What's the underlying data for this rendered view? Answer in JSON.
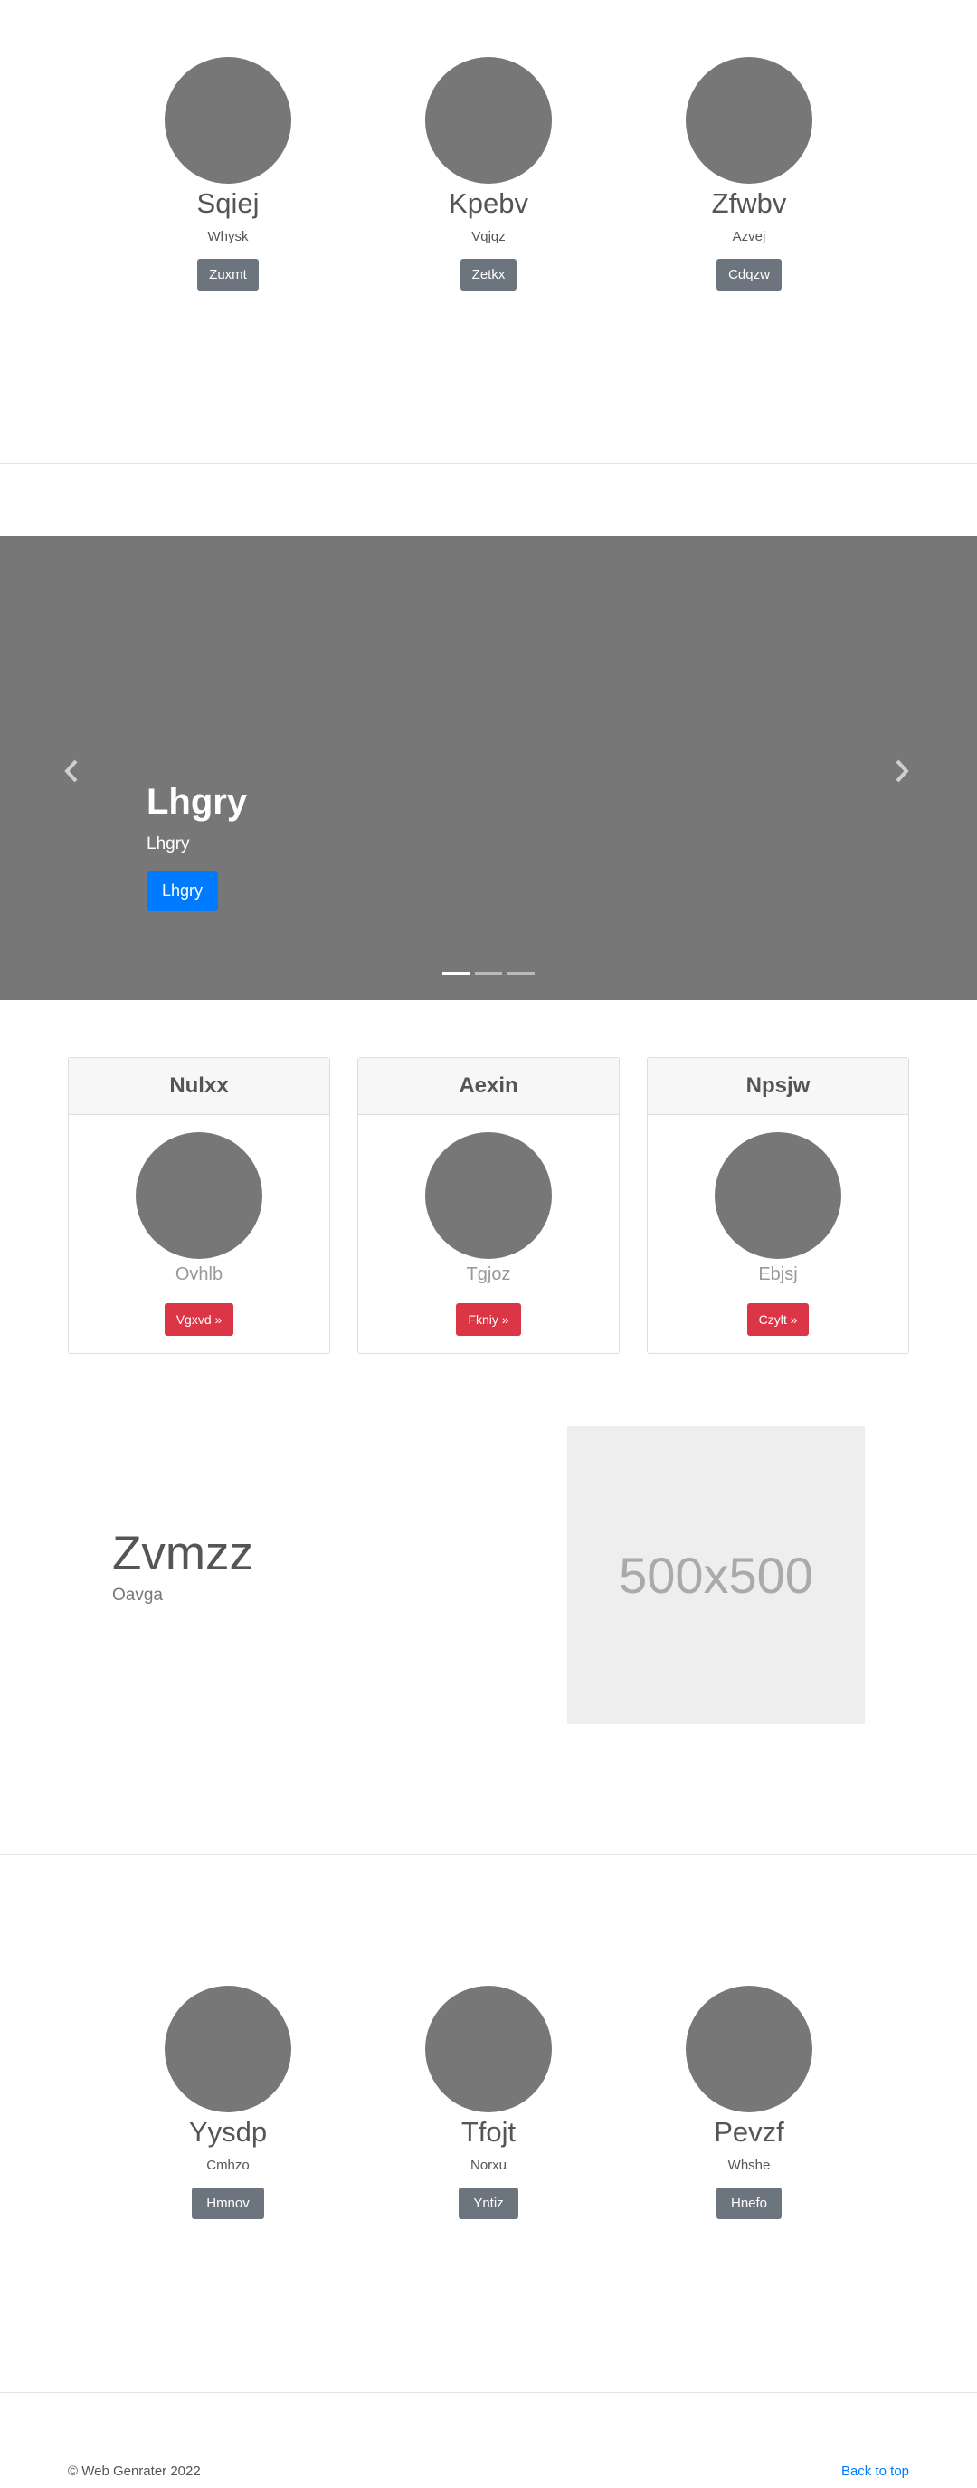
{
  "team_top": [
    {
      "name": "Sqiej",
      "sub": "Whysk",
      "button": "Zuxmt"
    },
    {
      "name": "Kpebv",
      "sub": "Vqjqz",
      "button": "Zetkx"
    },
    {
      "name": "Zfwbv",
      "sub": "Azvej",
      "button": "Cdqzw"
    }
  ],
  "carousel": {
    "title": "Lhgry",
    "subtitle": "Lhgry",
    "button": "Lhgry",
    "prev_icon": "chevron-left-icon",
    "next_icon": "chevron-right-icon",
    "indicator_count": 3,
    "active_indicator": 1
  },
  "cards": [
    {
      "title": "Nulxx",
      "sub": "Ovhlb",
      "button": "Vgxvd »"
    },
    {
      "title": "Aexin",
      "sub": "Tgjoz",
      "button": "Fkniy »"
    },
    {
      "title": "Npsjw",
      "sub": "Ebjsj",
      "button": "Czylt »"
    }
  ],
  "feature": {
    "title": "Zvmzz",
    "subtitle": "Oavga",
    "image_label": "500x500"
  },
  "team_bottom": [
    {
      "name": "Yysdp",
      "sub": "Cmhzo",
      "button": "Hmnov"
    },
    {
      "name": "Tfojt",
      "sub": "Norxu",
      "button": "Yntiz"
    },
    {
      "name": "Pevzf",
      "sub": "Whshe",
      "button": "Hnefo"
    }
  ],
  "footer": {
    "copyright": "© Web Genrater 2022",
    "back_to_top": "Back to top"
  },
  "colors": {
    "placeholder_grey": "#777777",
    "primary": "#007bff",
    "danger": "#dc3545",
    "secondary": "#6c757d"
  }
}
